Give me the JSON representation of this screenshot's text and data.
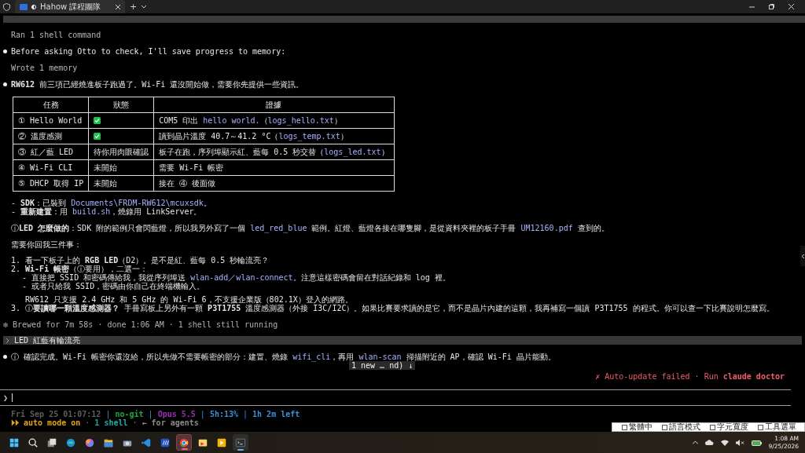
{
  "browser": {
    "tab_title": "Hahow 課程團隊",
    "new_tab": "+"
  },
  "transcript": [
    {
      "kind": "collapsed"
    },
    {
      "kind": "tool",
      "text": "Ran 1 shell command"
    },
    {
      "kind": "message",
      "parts": [
        {
          "text": "Before asking Otto to check, I'll save progress to memory:"
        }
      ]
    },
    {
      "kind": "tool",
      "text": "Wrote 1 memory"
    },
    {
      "kind": "message",
      "parts": [
        {
          "text": "RW612",
          "kind": "bold"
        },
        {
          "text": " 前三項已經燒進板子跑過了。Wi-Fi 還沒開始做，需要你先提供一些資訊。"
        }
      ]
    },
    {
      "kind": "table",
      "columns": [
        "任務",
        "狀態",
        "證據"
      ],
      "rows": [
        {
          "task": "① Hello World",
          "done": true,
          "evidence": [
            {
              "text": "COM5 印出 "
            },
            {
              "text": "hello world.",
              "kind": "code"
            },
            {
              "text": "（"
            },
            {
              "text": "logs_hello.txt",
              "kind": "code"
            },
            {
              "text": "）"
            }
          ]
        },
        {
          "task": "② 溫度感測",
          "done": true,
          "evidence": [
            {
              "text": "讀到晶片溫度 40.7～41.2 °C（"
            },
            {
              "text": "logs_temp.txt",
              "kind": "code"
            },
            {
              "text": "）"
            }
          ]
        },
        {
          "task": "③ 紅／藍 LED",
          "done": false,
          "status": "待你用肉眼確認",
          "evidence": [
            {
              "text": "板子在跑，序列埠顯示紅、藍每 0.5 秒交替（"
            },
            {
              "text": "logs_led.txt",
              "kind": "code"
            },
            {
              "text": "）"
            }
          ]
        },
        {
          "task": "④ Wi-Fi CLI",
          "done": false,
          "status": "未開始",
          "evidence": [
            {
              "text": "需要 Wi-Fi 帳密"
            }
          ]
        },
        {
          "task": "⑤ DHCP 取得 IP",
          "done": false,
          "status": "未開始",
          "evidence": [
            {
              "text": "接在 ④ 後面做"
            }
          ]
        }
      ]
    },
    {
      "kind": "bullets",
      "items": [
        {
          "marker": "-",
          "parts": [
            {
              "text": "SDK",
              "kind": "bold"
            },
            {
              "text": "：已裝到 "
            },
            {
              "text": "Documents\\FRDM-RW612\\mcuxsdk",
              "kind": "code"
            },
            {
              "text": "。"
            }
          ]
        },
        {
          "marker": "-",
          "parts": [
            {
              "text": "重新建置",
              "kind": "bold"
            },
            {
              "text": "：用 "
            },
            {
              "text": "build.sh",
              "kind": "code"
            },
            {
              "text": "，燒錄用 LinkServer。"
            }
          ]
        }
      ]
    },
    {
      "kind": "paragraph",
      "parts": [
        {
          "text": "ⓘ"
        },
        {
          "text": "LED 怎麼做的",
          "kind": "bold"
        },
        {
          "text": "：SDK 附的範例只會閃藍燈，所以我另外寫了一個 "
        },
        {
          "text": "led_red_blue",
          "kind": "code"
        },
        {
          "text": " 範例。紅燈、藍燈各接在哪隻腳，是從資料夾裡的板子手冊 "
        },
        {
          "text": "UM12160.pdf",
          "kind": "code"
        },
        {
          "text": " 查到的。"
        }
      ]
    },
    {
      "kind": "paragraph",
      "parts": [
        {
          "text": "需要你回我三件事："
        }
      ]
    },
    {
      "kind": "list",
      "items": [
        {
          "marker": "1.",
          "parts": [
            {
              "text": "看一下板子上的 "
            },
            {
              "text": "RGB LED",
              "kind": "bold"
            },
            {
              "text": "（D2）。是不是紅、藍每 0.5 秒輪流亮？"
            }
          ]
        },
        {
          "marker": "2.",
          "parts": [
            {
              "text": "Wi-Fi 帳密",
              "kind": "bold"
            },
            {
              "text": "（ⓘ要用），二選一："
            }
          ],
          "children": [
            {
              "kind": "bullet",
              "marker": "-",
              "parts": [
                {
                  "text": "直接把 SSID 和密碼傳給我，我從序列埠送 "
                },
                {
                  "text": "wlan-add／wlan-connect",
                  "kind": "code"
                },
                {
                  "text": "。注意這樣密碼會留在對話紀錄和 log 裡。"
                }
              ]
            },
            {
              "kind": "bullet",
              "marker": "-",
              "parts": [
                {
                  "text": "或者只給我 SSID，密碼由你自己在終端機輸入。"
                }
              ]
            },
            {
              "kind": "note",
              "parts": [
                {
                  "text": "RW612 只支援 2.4 GHz 和 5 GHz 的 Wi-Fi 6，不支援企業版（802.1X）登入的網路。"
                }
              ]
            }
          ]
        },
        {
          "marker": "3.",
          "parts": [
            {
              "text": "ⓘ"
            },
            {
              "text": "要讀哪一顆溫度感測器？",
              "kind": "bold"
            },
            {
              "text": " 手冊寫板上另外有一顆 "
            },
            {
              "text": "P3T1755",
              "kind": "bold"
            },
            {
              "text": " 溫度感測器（外接 I3C/I2C）。如果比賽要求讀的是它，而不是晶片內建的這顆，我再補寫一個讀 P3T1755 的程式。你可以查一下比賽說明怎麼寫。"
            }
          ]
        }
      ]
    },
    {
      "kind": "status",
      "text": "✻ Brewed for 7m 58s · done 1:06 AM · 1 shell still running"
    },
    {
      "kind": "user",
      "text": "LED 紅藍有輪流亮"
    },
    {
      "kind": "message",
      "parts": [
        {
          "text": "ⓘ 確認完成。Wi-Fi 帳密你還沒給，所以先做不需要帳密的部分：建置、燒錄 "
        },
        {
          "text": "wifi_cli",
          "kind": "code"
        },
        {
          "text": "，再用 "
        },
        {
          "text": "wlan-scan",
          "kind": "code"
        },
        {
          "text": " 掃描附近的 AP，確認 Wi-Fi 晶片能動。"
        }
      ]
    },
    {
      "kind": "pill",
      "text": "1 new … nd) ↓"
    },
    {
      "kind": "alert",
      "parts": [
        {
          "text": "✗ Auto-update failed · Run "
        },
        {
          "text": "claude doctor",
          "kind": "bold"
        }
      ]
    }
  ],
  "prompt": {
    "symbol": "❯"
  },
  "statusline": {
    "separator": "|",
    "segments": [
      {
        "text": "Fri Sep 25 01:07:12",
        "color": "#5e5e5e"
      },
      {
        "text": "no-git",
        "color": "#1fa83c"
      },
      {
        "text": "Opus 5.5",
        "color": "#9a2fb0"
      },
      {
        "text": "5h:13%",
        "color": "#3a8fd8"
      },
      {
        "text": "1h 2m left",
        "color": "#3a8fd8"
      }
    ]
  },
  "modeline": {
    "separator": "·",
    "segments": [
      {
        "text": "⏵⏵ auto mode on",
        "color": "#e0a21a"
      },
      {
        "text": "1 shell",
        "color": "#25a8a8"
      },
      {
        "text": "← for agents",
        "color": "#8a8a8a"
      }
    ]
  },
  "ime": [
    "繁體中",
    "語言模式",
    "字元寬度",
    "工具選單"
  ],
  "taskbar": {
    "apps": [
      {
        "kind": "start",
        "selected": false,
        "running": false
      },
      {
        "kind": "search",
        "selected": false,
        "running": false
      },
      {
        "kind": "taskview",
        "selected": false,
        "running": false
      },
      {
        "kind": "edge",
        "selected": false,
        "running": false
      },
      {
        "kind": "copilot",
        "selected": false,
        "running": false
      },
      {
        "kind": "files",
        "selected": false,
        "running": false
      },
      {
        "kind": "camera",
        "selected": false,
        "running": false
      },
      {
        "kind": "vscode",
        "selected": false,
        "running": false
      },
      {
        "kind": "calc",
        "selected": false,
        "running": false
      },
      {
        "kind": "chrome",
        "selected": true,
        "running": true
      },
      {
        "kind": "gallery",
        "selected": false,
        "running": false
      },
      {
        "kind": "slides",
        "selected": false,
        "running": false
      },
      {
        "kind": "terminal",
        "selected": false,
        "running": true
      }
    ],
    "time": "1:08 AM",
    "date": "9/25/2026"
  }
}
